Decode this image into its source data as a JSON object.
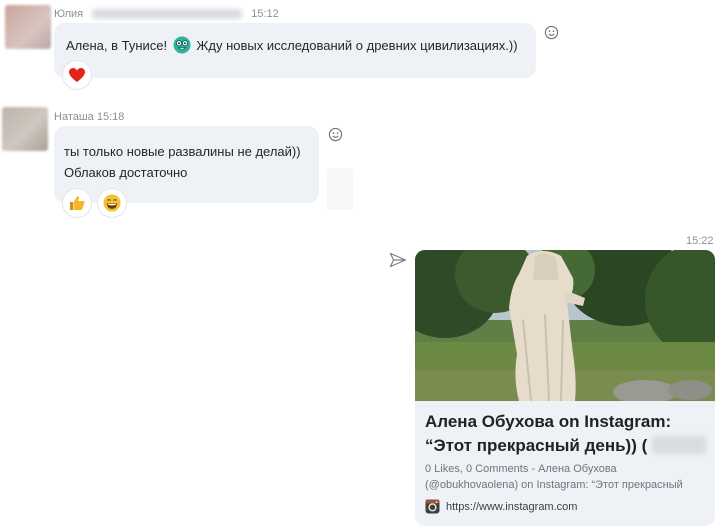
{
  "messages": [
    {
      "sender": "Юлия",
      "time": "15:12",
      "text": "Алена, в Тунисе! Жду новых исследований о древних цивилизациях.))",
      "text_part1": "Алена, в Тунисе!",
      "text_part2": "Жду новых исследований о древних цивилизациях.))",
      "emoji": "nerd-face-emoji",
      "reactions": [
        "heart"
      ]
    },
    {
      "sender": "Наташа",
      "time": "15:18",
      "lines": [
        "ты только новые развалины не делай))",
        "Облаков достаточно"
      ],
      "reactions": [
        "thumbs-up",
        "laughing-face"
      ]
    }
  ],
  "outgoing": {
    "time": "15:22",
    "card": {
      "title_line1": "Алена Обухова on Instagram:",
      "title_line2": "“Этот прекрасный день)) (",
      "desc_line1": "0 Likes, 0 Comments - Алена Обухова",
      "desc_line2": "(@obukhovaolena) on Instagram: “Этот прекрасный",
      "source_url": "https://www.instagram.com",
      "source_icon": "instagram-icon"
    }
  },
  "colors": {
    "bubble_incoming": "#eef1f6",
    "heart": "#e0241b",
    "link_title": "#222222"
  }
}
